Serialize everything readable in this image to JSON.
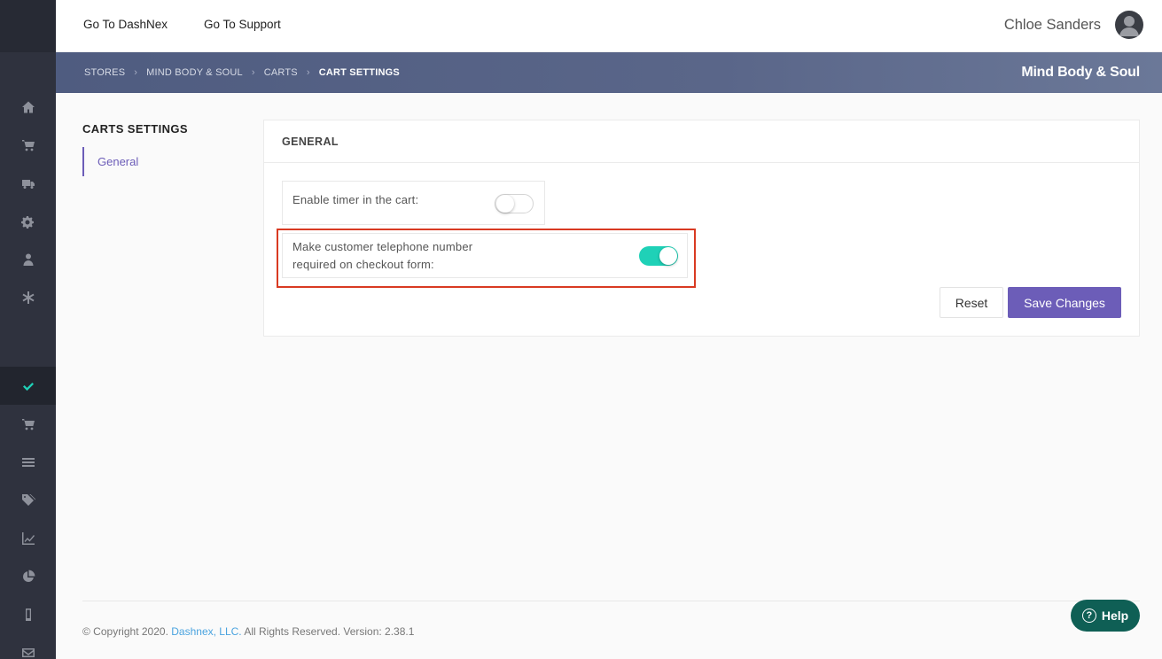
{
  "topbar": {
    "links": [
      "Go To DashNex",
      "Go To Support"
    ],
    "user_name": "Chloe Sanders"
  },
  "breadcrumb": {
    "items": [
      "STORES",
      "MIND BODY & SOUL",
      "CARTS"
    ],
    "current": "CART SETTINGS",
    "separator": "›",
    "store_title": "Mind Body & Soul"
  },
  "settings_nav": {
    "title": "CARTS SETTINGS",
    "items": [
      "General"
    ]
  },
  "card": {
    "title": "GENERAL",
    "settings": [
      {
        "label": "Enable timer in the cart:",
        "enabled": false
      },
      {
        "label_line1": "Make customer telephone number",
        "label_line2": "required on checkout form:",
        "enabled": true
      }
    ],
    "reset_label": "Reset",
    "save_label": "Save Changes"
  },
  "footer": {
    "prefix": "© Copyright 2020.",
    "company": "Dashnex, LLC.",
    "suffix": "All Rights Reserved. Version: 2.38.1"
  },
  "help": {
    "label": "Help",
    "glyph": "?"
  },
  "colors": {
    "accent": "#6c5db8",
    "toggle_on": "#1fd1b7",
    "highlight": "#d93a22",
    "help": "#0f5f55"
  },
  "sidebar_icons": [
    "home-icon",
    "cart-icon",
    "truck-icon",
    "gears-icon",
    "user-icon",
    "asterisk-icon",
    "check-icon",
    "cart-icon",
    "list-icon",
    "tags-icon",
    "line-chart-icon",
    "pie-chart-icon",
    "mobile-icon",
    "envelope-icon"
  ]
}
